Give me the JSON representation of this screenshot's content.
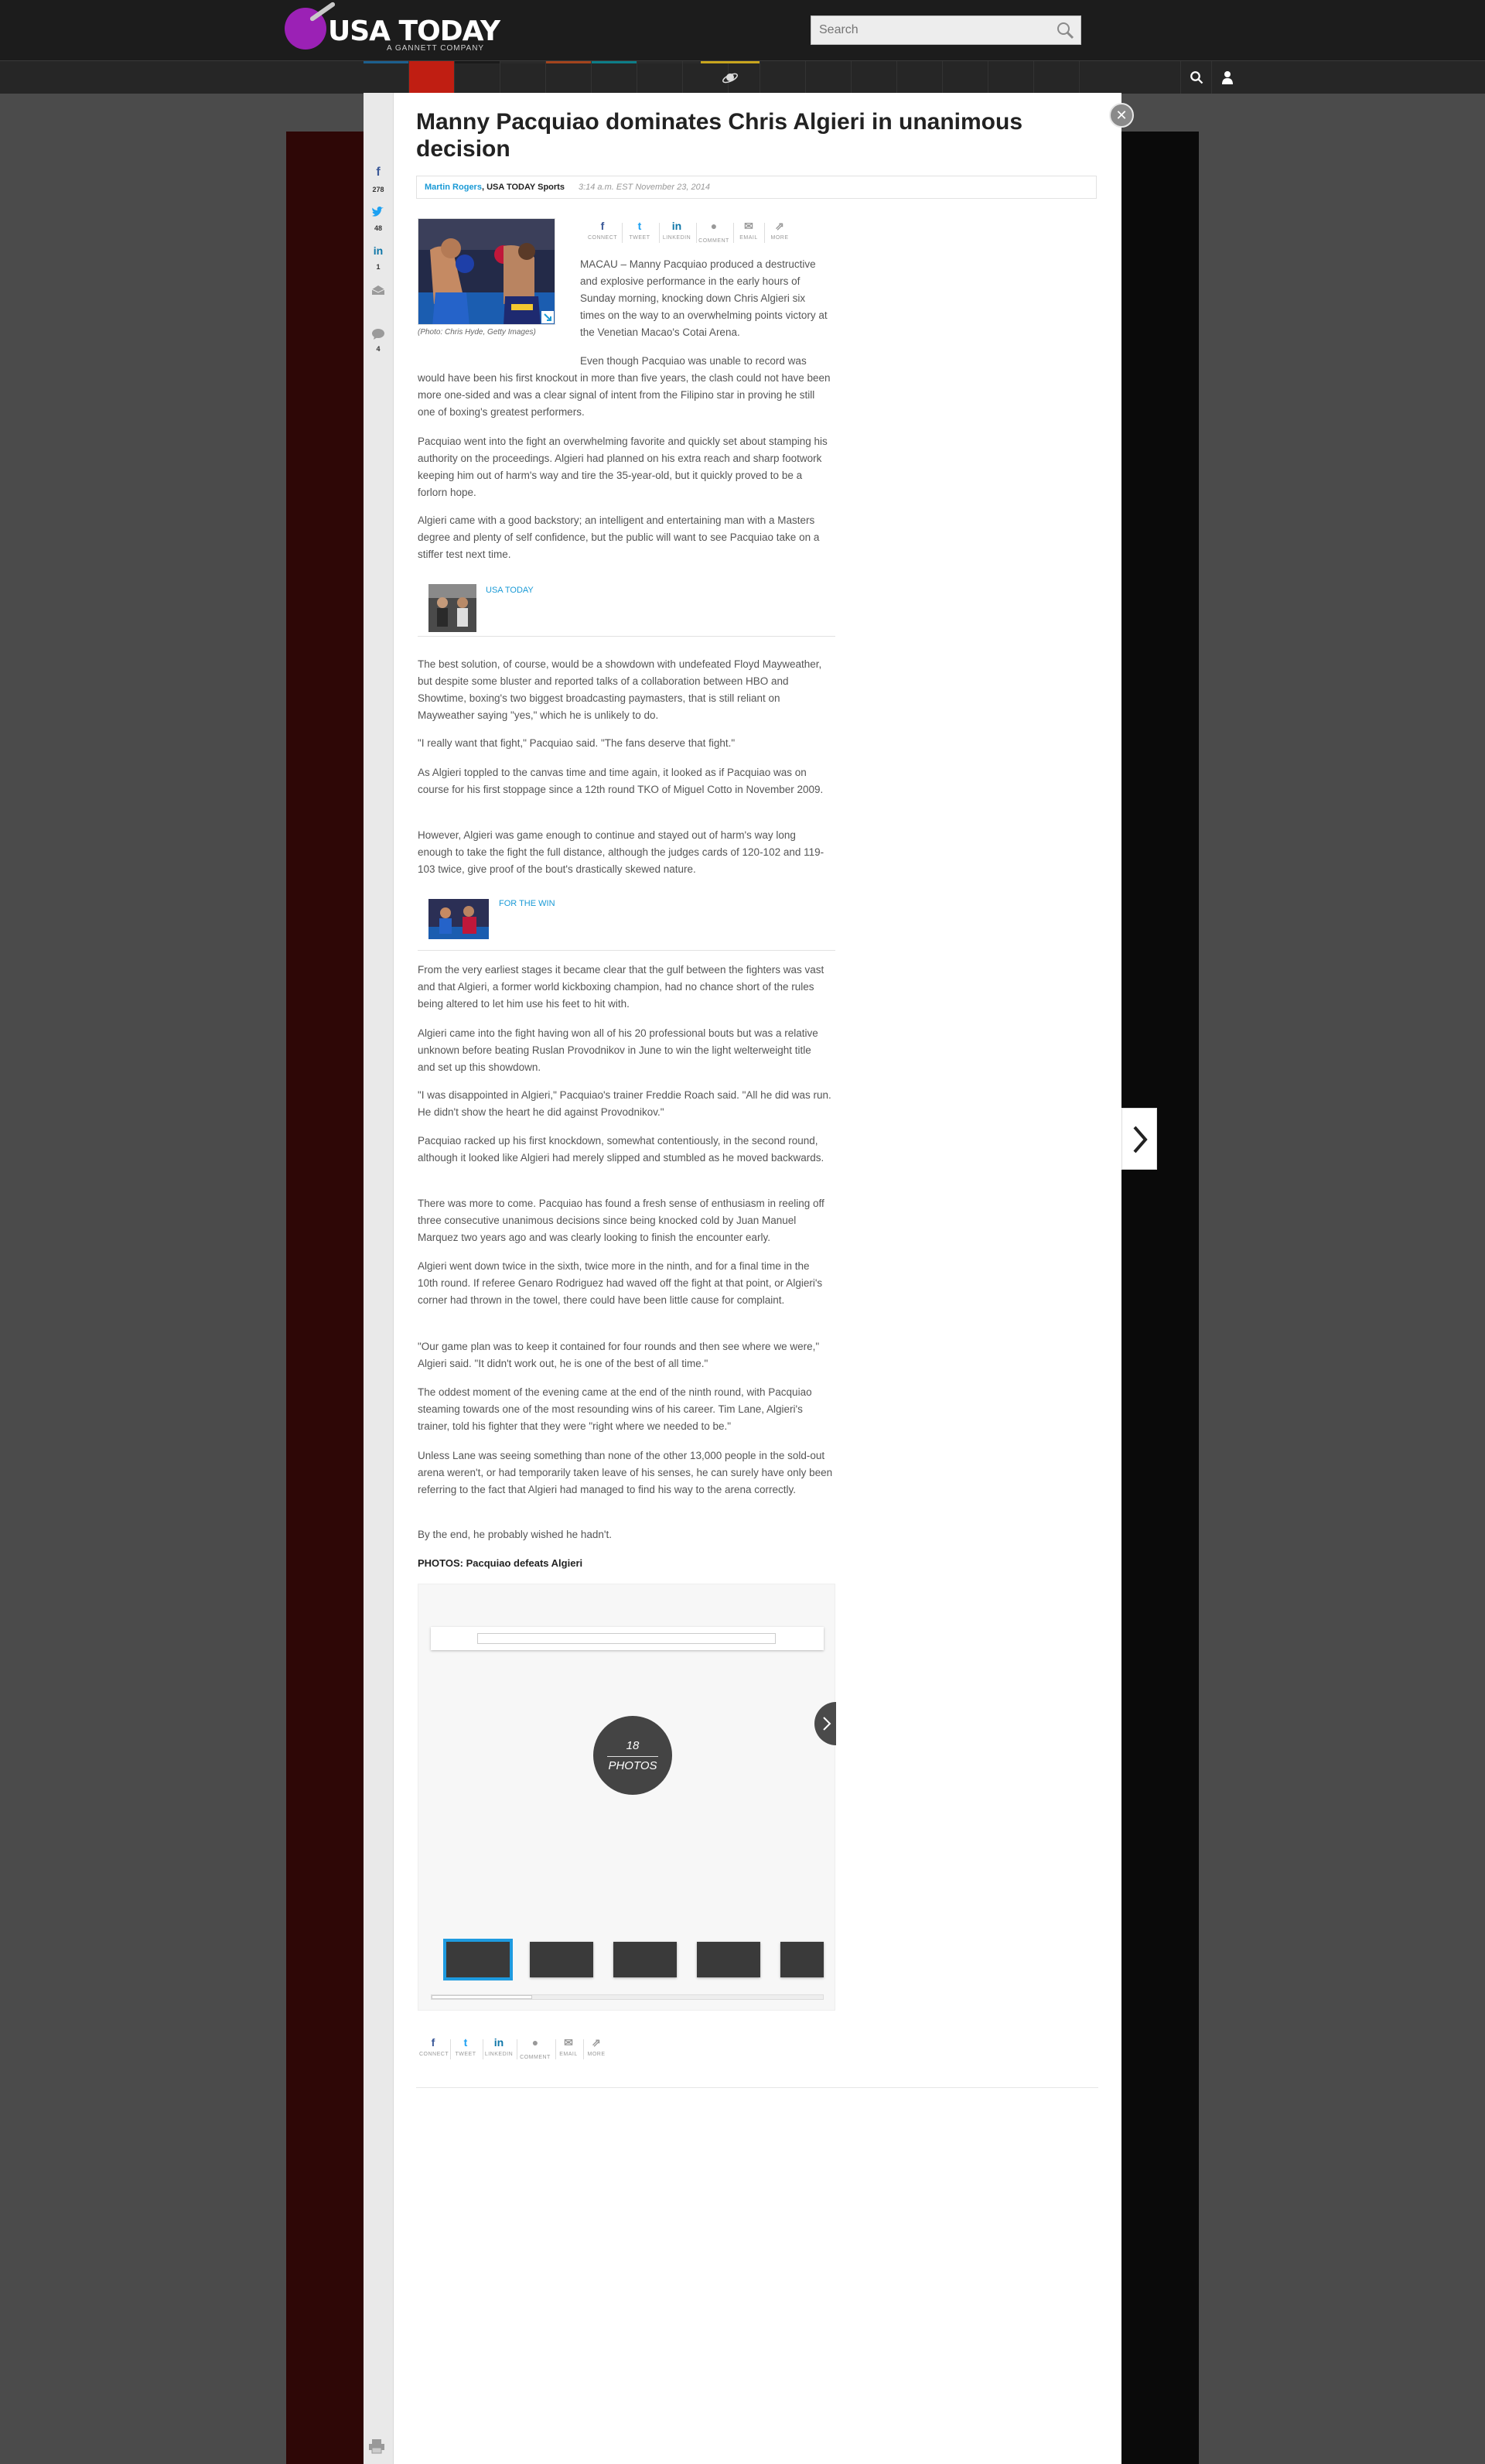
{
  "site": {
    "logo_text": "USA TODAY",
    "logo_sub": "A GANNETT COMPANY",
    "search_placeholder": "Search"
  },
  "colors": {
    "brand_purple": "#9b21b5",
    "link_blue": "#1a9ad6",
    "nav_active_red": "#c01e12",
    "gallery_active": "#1e9be0"
  },
  "share_rail": [
    {
      "icon": "facebook-icon",
      "glyph": "f",
      "count": "278"
    },
    {
      "icon": "twitter-icon",
      "glyph": "t",
      "count": "48"
    },
    {
      "icon": "linkedin-icon",
      "glyph": "in",
      "count": "1"
    },
    {
      "icon": "email-icon",
      "glyph": "✉",
      "count": ""
    },
    {
      "icon": "comment-icon",
      "glyph": "●",
      "count": "4"
    }
  ],
  "article": {
    "headline": "Manny Pacquiao dominates Chris Algieri in unanimous decision",
    "author": "Martin Rogers",
    "org": ", USA TODAY Sports",
    "timestamp": "3:14 a.m. EST November 23, 2014",
    "photo_caption": "(Photo: Chris Hyde, Getty Images)",
    "share_labels": [
      "CONNECT",
      "TWEET",
      "LINKEDIN",
      "COMMENT",
      "EMAIL",
      "MORE"
    ],
    "paragraphs": [
      "MACAU – Manny Pacquiao produced a destructive and explosive performance in the early hours of Sunday morning, knocking down Chris Algieri six times on the way to an overwhelming points victory at the Venetian Macao's Cotai Arena.",
      "Even though Pacquiao was unable to record was would have been his first knockout in more than five years, the clash could not have been more one-sided and was a clear signal of intent from the Filipino star in proving he still one of boxing's greatest performers.",
      "Pacquiao went into the fight an overwhelming favorite and quickly set about stamping his authority on the proceedings. Algieri had planned on his extra reach and sharp footwork keeping him out of harm's way and tire the 35-year-old, but it quickly proved to be a forlorn hope.",
      "Algieri came with a good backstory; an intelligent and entertaining man with a Masters degree and plenty of self confidence, but the public will want to see Pacquiao take on a stiffer test next time.",
      "The best solution, of course, would be a showdown with undefeated Floyd Mayweather, but despite some bluster and reported talks of a collaboration between HBO and Showtime, boxing's two biggest broadcasting paymasters, that is still reliant on Mayweather saying \"yes,\" which he is unlikely to do.",
      "\"I really want that fight,\" Pacquiao said. \"The fans deserve that fight.\"",
      "As Algieri toppled to the canvas time and time again, it looked as if Pacquiao was on course for his first stoppage since a 12th round TKO of Miguel Cotto in November 2009.",
      "However, Algieri was game enough to continue and stayed out of harm's way long enough to take the fight the full distance, although the judges cards of 120-102 and 119-103 twice, give proof of the bout's drastically skewed nature.",
      "From the very earliest stages it became clear that the gulf between the fighters was vast and that Algieri, a former world kickboxing champion, had no chance short of the rules being altered to let him use his feet to hit with.",
      "Algieri came into the fight having won all of his 20 professional bouts but was a relative unknown before beating Ruslan Provodnikov in June to win the light welterweight title and set up this showdown.",
      "\"I was disappointed in Algieri,\" Pacquiao's trainer Freddie Roach said. \"All he did was run. He didn't show the heart he did against Provodnikov.\"",
      "Pacquiao racked up his first knockdown, somewhat contentiously, in the second round, although it looked like Algieri had merely slipped and stumbled as he moved backwards.",
      "There was more to come. Pacquiao has found a fresh sense of enthusiasm in reeling off three consecutive unanimous decisions since being knocked cold by Juan Manuel Marquez two years ago and was clearly looking to finish the encounter early.",
      "Algieri went down twice in the sixth, twice more in the ninth, and for a final time in the 10th round. If referee Genaro Rodriguez had waved off the fight at that point, or Algieri's corner had thrown in the towel, there could have been little cause for complaint.",
      "\"Our game plan was to keep it contained for four rounds and then see where we were,\" Algieri said. \"It didn't work out, he is one of the best of all time.\"",
      "The oddest moment of the evening came at the end of the ninth round, with Pacquiao steaming towards one of the most resounding wins of his career. Tim Lane, Algieri's trainer, told his fighter that they were \"right where we needed to be.\"",
      "Unless Lane was seeing something than none of the other 13,000 people in the sold-out arena weren't, or had temporarily taken leave of his senses, he can surely have only been referring to the fact that Algieri had managed to find his way to the arena correctly.",
      "By the end, he probably wished he hadn't."
    ],
    "related": [
      {
        "source": "USA TODAY"
      },
      {
        "source": "FOR THE WIN"
      }
    ],
    "photos_heading": "PHOTOS: Pacquiao defeats Algieri",
    "gallery": {
      "count": "18",
      "label": "PHOTOS"
    }
  }
}
